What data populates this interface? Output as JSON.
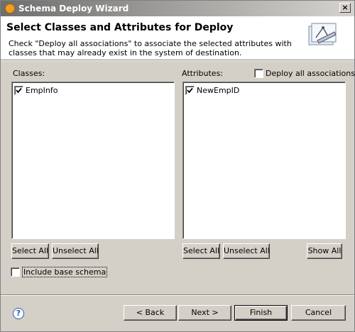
{
  "window": {
    "title": "Schema Deploy Wizard",
    "close_glyph": "×"
  },
  "header": {
    "title": "Select Classes and Attributes for Deploy",
    "description": "Check \"Deploy all associations\" to associate the selected attributes with classes that may already exist in the system of destination.",
    "icon": "schema-wizard-icon"
  },
  "classes": {
    "label": "Classes:",
    "items": [
      {
        "label": "EmpInfo",
        "checked": true
      }
    ],
    "select_all_label": "Select All",
    "unselect_all_label": "Unselect All"
  },
  "attributes": {
    "label": "Attributes:",
    "deploy_all_label": "Deploy all associations",
    "deploy_all_checked": false,
    "items": [
      {
        "label": "NewEmpID",
        "checked": true
      }
    ],
    "select_all_label": "Select All",
    "unselect_all_label": "Unselect All",
    "show_all_label": "Show All"
  },
  "include_base_schema": {
    "label": "Include base schema",
    "checked": false
  },
  "footer": {
    "help_icon": "help-icon",
    "back_label": "< Back",
    "next_label": "Next >",
    "finish_label": "Finish",
    "cancel_label": "Cancel"
  }
}
